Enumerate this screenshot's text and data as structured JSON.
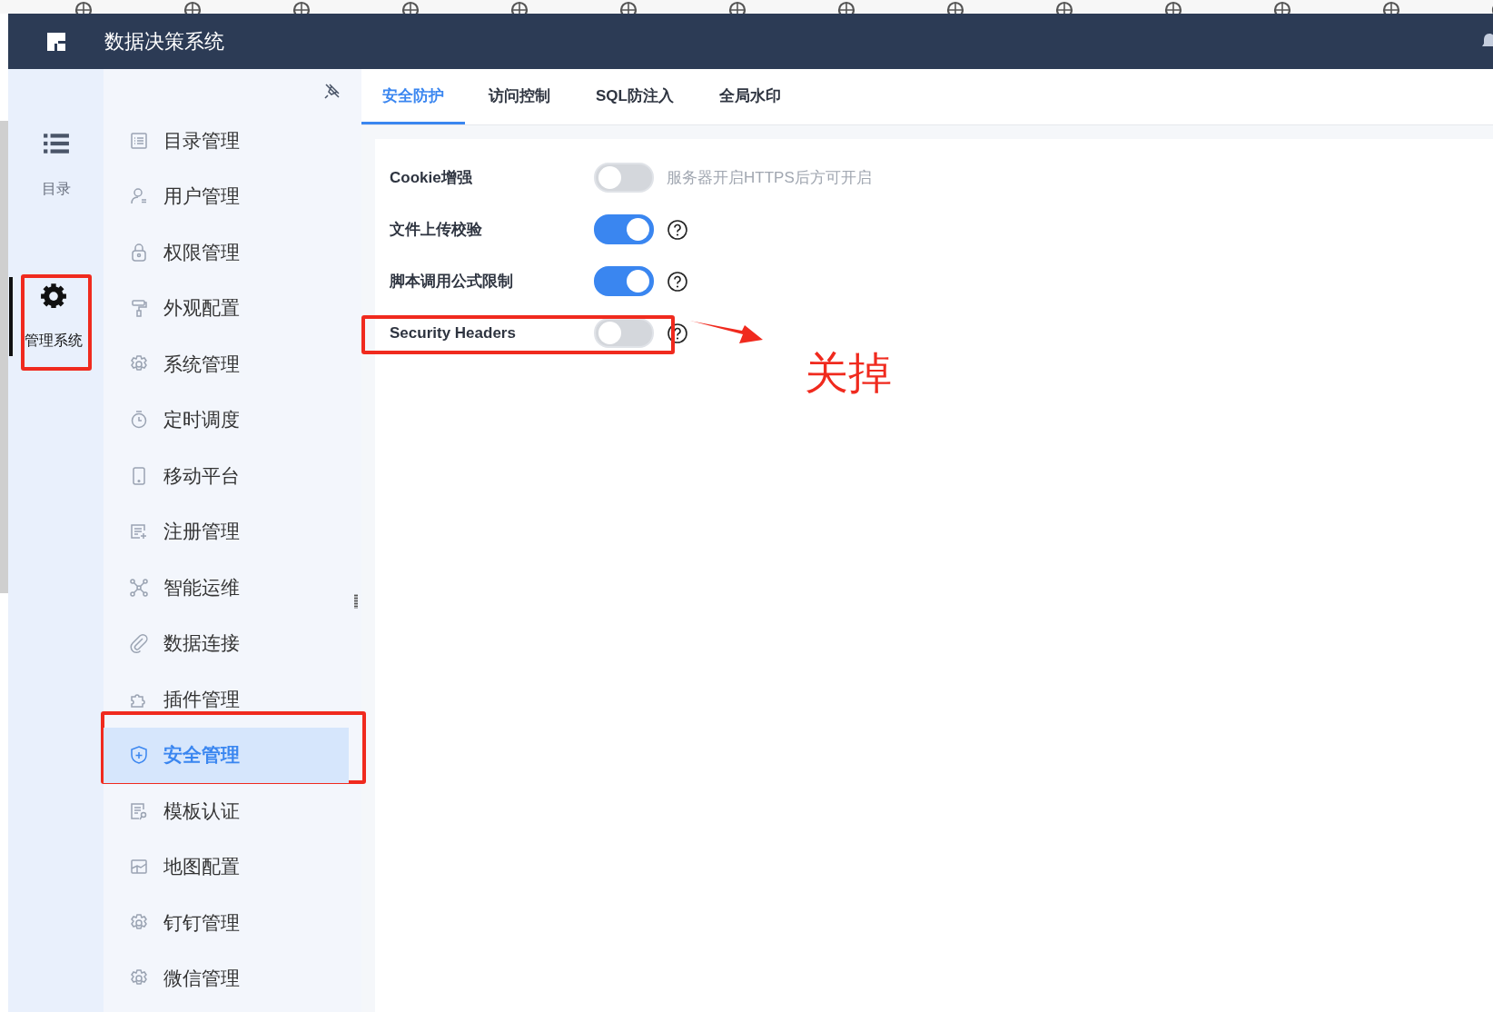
{
  "header": {
    "title": "数据决策系统"
  },
  "rail": [
    {
      "label": "目录",
      "selected": false
    },
    {
      "label": "管理系统",
      "selected": true
    }
  ],
  "nav": [
    {
      "label": "目录管理",
      "selected": false
    },
    {
      "label": "用户管理",
      "selected": false
    },
    {
      "label": "权限管理",
      "selected": false
    },
    {
      "label": "外观配置",
      "selected": false
    },
    {
      "label": "系统管理",
      "selected": false
    },
    {
      "label": "定时调度",
      "selected": false
    },
    {
      "label": "移动平台",
      "selected": false
    },
    {
      "label": "注册管理",
      "selected": false
    },
    {
      "label": "智能运维",
      "selected": false
    },
    {
      "label": "数据连接",
      "selected": false
    },
    {
      "label": "插件管理",
      "selected": false
    },
    {
      "label": "安全管理",
      "selected": true
    },
    {
      "label": "模板认证",
      "selected": false
    },
    {
      "label": "地图配置",
      "selected": false
    },
    {
      "label": "钉钉管理",
      "selected": false
    },
    {
      "label": "微信管理",
      "selected": false
    }
  ],
  "tabs": [
    {
      "label": "安全防护",
      "selected": true
    },
    {
      "label": "访问控制",
      "selected": false
    },
    {
      "label": "SQL防注入",
      "selected": false
    },
    {
      "label": "全局水印",
      "selected": false
    }
  ],
  "settings": [
    {
      "label": "Cookie增强",
      "on": false,
      "hint": "服务器开启HTTPS后方可开启",
      "help": false
    },
    {
      "label": "文件上传校验",
      "on": true,
      "help": true
    },
    {
      "label": "脚本调用公式限制",
      "on": true,
      "help": true
    },
    {
      "label": "Security Headers",
      "on": false,
      "help": true
    }
  ],
  "annotation": {
    "note": "关掉"
  }
}
